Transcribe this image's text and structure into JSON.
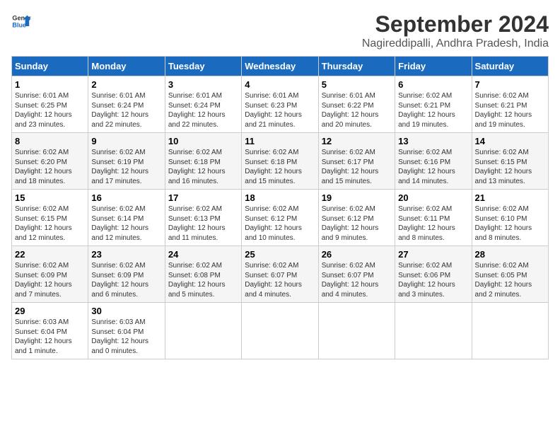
{
  "logo": {
    "line1": "General",
    "line2": "Blue"
  },
  "title": "September 2024",
  "location": "Nagireddipalli, Andhra Pradesh, India",
  "days_of_week": [
    "Sunday",
    "Monday",
    "Tuesday",
    "Wednesday",
    "Thursday",
    "Friday",
    "Saturday"
  ],
  "weeks": [
    [
      {
        "day": "1",
        "sunrise": "6:01 AM",
        "sunset": "6:25 PM",
        "daylight": "12 hours and 23 minutes."
      },
      {
        "day": "2",
        "sunrise": "6:01 AM",
        "sunset": "6:24 PM",
        "daylight": "12 hours and 22 minutes."
      },
      {
        "day": "3",
        "sunrise": "6:01 AM",
        "sunset": "6:24 PM",
        "daylight": "12 hours and 22 minutes."
      },
      {
        "day": "4",
        "sunrise": "6:01 AM",
        "sunset": "6:23 PM",
        "daylight": "12 hours and 21 minutes."
      },
      {
        "day": "5",
        "sunrise": "6:01 AM",
        "sunset": "6:22 PM",
        "daylight": "12 hours and 20 minutes."
      },
      {
        "day": "6",
        "sunrise": "6:02 AM",
        "sunset": "6:21 PM",
        "daylight": "12 hours and 19 minutes."
      },
      {
        "day": "7",
        "sunrise": "6:02 AM",
        "sunset": "6:21 PM",
        "daylight": "12 hours and 19 minutes."
      }
    ],
    [
      {
        "day": "8",
        "sunrise": "6:02 AM",
        "sunset": "6:20 PM",
        "daylight": "12 hours and 18 minutes."
      },
      {
        "day": "9",
        "sunrise": "6:02 AM",
        "sunset": "6:19 PM",
        "daylight": "12 hours and 17 minutes."
      },
      {
        "day": "10",
        "sunrise": "6:02 AM",
        "sunset": "6:18 PM",
        "daylight": "12 hours and 16 minutes."
      },
      {
        "day": "11",
        "sunrise": "6:02 AM",
        "sunset": "6:18 PM",
        "daylight": "12 hours and 15 minutes."
      },
      {
        "day": "12",
        "sunrise": "6:02 AM",
        "sunset": "6:17 PM",
        "daylight": "12 hours and 15 minutes."
      },
      {
        "day": "13",
        "sunrise": "6:02 AM",
        "sunset": "6:16 PM",
        "daylight": "12 hours and 14 minutes."
      },
      {
        "day": "14",
        "sunrise": "6:02 AM",
        "sunset": "6:15 PM",
        "daylight": "12 hours and 13 minutes."
      }
    ],
    [
      {
        "day": "15",
        "sunrise": "6:02 AM",
        "sunset": "6:15 PM",
        "daylight": "12 hours and 12 minutes."
      },
      {
        "day": "16",
        "sunrise": "6:02 AM",
        "sunset": "6:14 PM",
        "daylight": "12 hours and 12 minutes."
      },
      {
        "day": "17",
        "sunrise": "6:02 AM",
        "sunset": "6:13 PM",
        "daylight": "12 hours and 11 minutes."
      },
      {
        "day": "18",
        "sunrise": "6:02 AM",
        "sunset": "6:12 PM",
        "daylight": "12 hours and 10 minutes."
      },
      {
        "day": "19",
        "sunrise": "6:02 AM",
        "sunset": "6:12 PM",
        "daylight": "12 hours and 9 minutes."
      },
      {
        "day": "20",
        "sunrise": "6:02 AM",
        "sunset": "6:11 PM",
        "daylight": "12 hours and 8 minutes."
      },
      {
        "day": "21",
        "sunrise": "6:02 AM",
        "sunset": "6:10 PM",
        "daylight": "12 hours and 8 minutes."
      }
    ],
    [
      {
        "day": "22",
        "sunrise": "6:02 AM",
        "sunset": "6:09 PM",
        "daylight": "12 hours and 7 minutes."
      },
      {
        "day": "23",
        "sunrise": "6:02 AM",
        "sunset": "6:09 PM",
        "daylight": "12 hours and 6 minutes."
      },
      {
        "day": "24",
        "sunrise": "6:02 AM",
        "sunset": "6:08 PM",
        "daylight": "12 hours and 5 minutes."
      },
      {
        "day": "25",
        "sunrise": "6:02 AM",
        "sunset": "6:07 PM",
        "daylight": "12 hours and 4 minutes."
      },
      {
        "day": "26",
        "sunrise": "6:02 AM",
        "sunset": "6:07 PM",
        "daylight": "12 hours and 4 minutes."
      },
      {
        "day": "27",
        "sunrise": "6:02 AM",
        "sunset": "6:06 PM",
        "daylight": "12 hours and 3 minutes."
      },
      {
        "day": "28",
        "sunrise": "6:02 AM",
        "sunset": "6:05 PM",
        "daylight": "12 hours and 2 minutes."
      }
    ],
    [
      {
        "day": "29",
        "sunrise": "6:03 AM",
        "sunset": "6:04 PM",
        "daylight": "12 hours and 1 minute."
      },
      {
        "day": "30",
        "sunrise": "6:03 AM",
        "sunset": "6:04 PM",
        "daylight": "12 hours and 0 minutes."
      },
      null,
      null,
      null,
      null,
      null
    ]
  ]
}
